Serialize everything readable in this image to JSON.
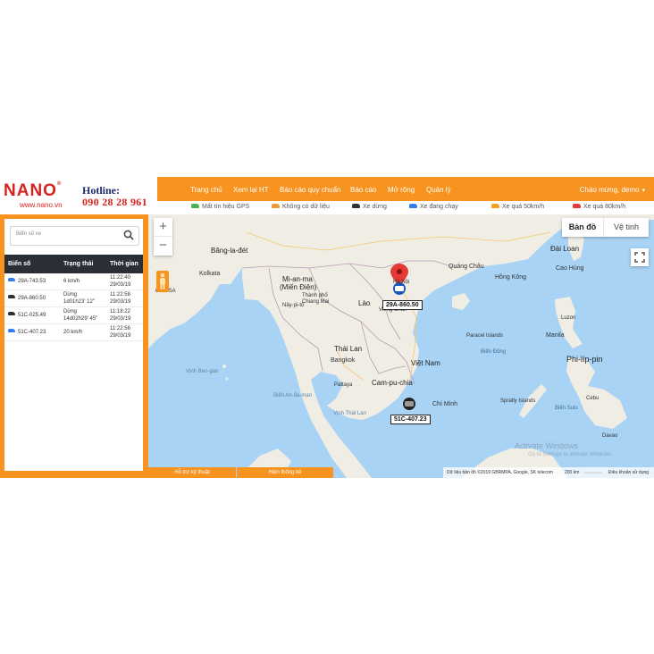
{
  "brand": {
    "logo": "NANO",
    "logo_mark": "®",
    "website": "www.nano.vn",
    "hotline_label": "Hotline:",
    "hotline_number": "090 28 28 961"
  },
  "nav": {
    "items": [
      "Trang chủ",
      "Xem lại HT",
      "Báo cáo quy chuẩn",
      "Báo cáo",
      "Mở rộng",
      "Quản lý"
    ],
    "greeting": "Chào mừng, demo"
  },
  "legend": {
    "items": [
      {
        "label": "Mất tín hiệu GPS",
        "color": "#4caf50"
      },
      {
        "label": "Không có dữ liệu",
        "color": "#f09a3e"
      },
      {
        "label": "Xe dừng",
        "color": "#333333"
      },
      {
        "label": "Xe đang chạy",
        "color": "#2f80ed"
      },
      {
        "label": "Xe quá 50km/h",
        "color": "#f7a21b"
      },
      {
        "label": "Xe quá 80km/h",
        "color": "#e53935"
      }
    ]
  },
  "sidebar": {
    "search_placeholder": "Biển số xe",
    "columns": [
      "Biển số",
      "Trạng thái",
      "Thời gian"
    ],
    "rows": [
      {
        "plate": "29A-743.53",
        "status": "6 km/h",
        "status2": "",
        "time": "11:22:40",
        "date": "29/03/19",
        "color": "#2f80ed"
      },
      {
        "plate": "29A-860.50",
        "status": "Dừng",
        "status2": "1d01h23' 12\"",
        "time": "11:22:58",
        "date": "29/03/19",
        "color": "#333333"
      },
      {
        "plate": "51C-025.49",
        "status": "Dừng",
        "status2": "14d02h29' 45\"",
        "time": "11:18:22",
        "date": "29/03/19",
        "color": "#333333"
      },
      {
        "plate": "51C-407.23",
        "status": "20 km/h",
        "status2": "",
        "time": "11:22:56",
        "date": "29/03/19",
        "color": "#2f80ed"
      }
    ]
  },
  "footer": {
    "support": "Hỗ trợ kỹ thuật",
    "stats": "Hiện thống kê"
  },
  "map": {
    "type_map": "Bản đồ",
    "type_satellite": "Vệ tinh",
    "zoom_in": "+",
    "zoom_out": "−",
    "places": {
      "dai_loan": "Đài Loan",
      "cao_hung": "Cao Hùng",
      "bang_la_det": "Băng-la-đét",
      "kolkata": "Kolkata",
      "orissa": "ORISSA",
      "mi_an_ma": "Mi-an-ma",
      "mien_dien": "(Miến Điện)",
      "nay_pi_to": "Nây-pi-tô",
      "chiang_mai": "Chiang Mai",
      "thanh_pho_chiang_mai": "Thành phố",
      "lao": "Lào",
      "vieng_chan": "Viêng Chăn",
      "quang_chau": "Quảng Châu",
      "hong_kong": "Hồng Kông",
      "thai_lan": "Thái Lan",
      "bangkok": "Bangkok",
      "viet_nam": "Việt Nam",
      "cam_pu_chia": "Cam-pu-chia",
      "chi_minh": "Chí Minh",
      "pattaya": "Pattaya",
      "ha_noi": "Hà Nội",
      "paracel": "Paracel Islands",
      "bien_dong": "Biển Đông",
      "spratly": "Spratly Islands",
      "phi_lip_pin": "Phi-líp-pin",
      "luzon": "Luzon",
      "manila": "Manila",
      "bien_sulu": "Biển Sulu",
      "cebu": "Cebu",
      "davao": "Davao",
      "vinh_ben_gan": "Vịnh Ben-gan",
      "bien_an_da_man": "Biển An-đa-man",
      "vinh_thai_lan": "Vịnh Thái Lan"
    },
    "vehicles": {
      "north": "29A-860.50",
      "south": "51C-407.23"
    },
    "watermark_title": "Activate Windows",
    "watermark_sub": "Go to Settings to activate Windows.",
    "attribution": "Dữ liệu bản đồ ©2019 GBRMPA, Google, SK telecom",
    "scale": "200 km",
    "terms": "Điều khoản sử dụng"
  }
}
